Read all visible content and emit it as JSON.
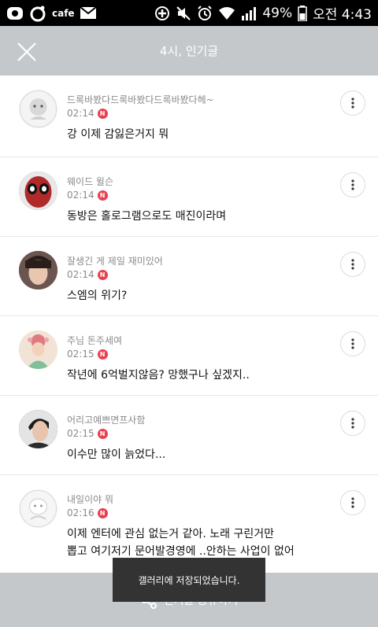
{
  "status_bar": {
    "left_text": "cafe",
    "battery_text": "49%",
    "time": "오전 4:43"
  },
  "header": {
    "title": "4시, 인기글"
  },
  "posts": [
    {
      "author": "드록바봤다드록바봤다드록바봤다헤~",
      "time": "02:14",
      "badge": "N",
      "title": "강 이제 감잃은거지 뭐",
      "avatar_color": "#eeeeee"
    },
    {
      "author": "웨이드 윌슨",
      "time": "02:14",
      "badge": "N",
      "title": "동방은 홀로그램으로도 매진이라며",
      "avatar_color": "#b02a2a"
    },
    {
      "author": "잘생긴 게 제일 재미있어",
      "time": "02:14",
      "badge": "N",
      "title": "스엠의 위기?",
      "avatar_color": "#5a4640"
    },
    {
      "author": "주님 돈주세여",
      "time": "02:15",
      "badge": "N",
      "title": "작년에 6억벌지않음? 망했구나 싶겠지..",
      "avatar_color": "#e9d6c6"
    },
    {
      "author": "어리고예쁘면프사함",
      "time": "02:15",
      "badge": "N",
      "title": "이수만 많이 늙었다...",
      "avatar_color": "#3f3a3a"
    },
    {
      "author": "내일이야 뭐",
      "time": "02:16",
      "badge": "N",
      "title_line1": "이제 엔터에 관심 없는거 같아. 노래 구린거만",
      "title_line2": "뽑고 여기저기 문어발경영에 ..안하는 사업이 없어",
      "avatar_color": "#f2f2f2"
    }
  ],
  "bottom_bar": {
    "label": "인기글 공유하기"
  },
  "toast": {
    "message": "갤러리에 저장되었습니다."
  },
  "colors": {
    "header_bg": "#c4c8cb",
    "badge_red": "#e8404f",
    "toast_bg": "#333333"
  },
  "icons": [
    "close-icon",
    "more-vertical-icon",
    "share-icon",
    "mail-icon",
    "wifi-icon",
    "signal-icon",
    "battery-icon",
    "alarm-icon",
    "mute-icon"
  ]
}
